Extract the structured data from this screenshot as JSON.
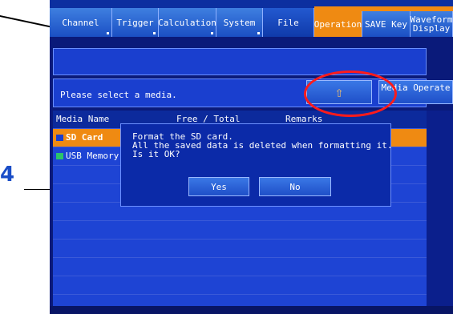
{
  "tabs": [
    {
      "label": "Channel"
    },
    {
      "label": "Trigger"
    },
    {
      "label": "Calculation"
    },
    {
      "label": "System"
    },
    {
      "label": "File"
    },
    {
      "label": "Operation"
    },
    {
      "label": "SAVE Key"
    },
    {
      "label": "Waveform Display"
    }
  ],
  "status": "Please select a media.",
  "media_operate": "Media Operate",
  "table": {
    "headers": [
      "Media Name",
      "Free / Total",
      "Remarks"
    ],
    "rows": [
      {
        "name": "SD Card",
        "selected": true
      },
      {
        "name": "USB Memory",
        "selected": false
      }
    ]
  },
  "dialog": {
    "message": "Format the SD card.\nAll the saved data is deleted when formatting it.\nIs it OK?",
    "yes": "Yes",
    "no": "No"
  },
  "callout": "4",
  "colors": {
    "accent": "#ef8a12",
    "screen": "#0a1a7a",
    "panel": "#1a3fcf",
    "highlight": "#ff1b1b"
  },
  "icons": [
    "up-arrow-icon",
    "sd-card-icon",
    "usb-icon"
  ]
}
